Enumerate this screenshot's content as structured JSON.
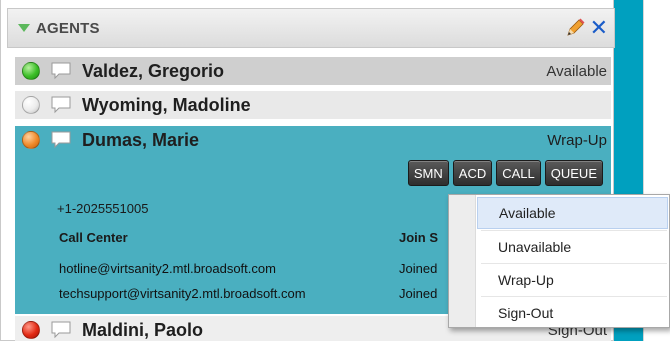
{
  "panel": {
    "title": "AGENTS"
  },
  "agents": [
    {
      "name": "Valdez, Gregorio",
      "status": "Available",
      "status_color": "green"
    },
    {
      "name": "Wyoming, Madoline",
      "status": "",
      "status_color": "white"
    },
    {
      "name": "Dumas, Marie",
      "status": "Wrap-Up",
      "status_color": "orange"
    },
    {
      "name": "Maldini, Paolo",
      "status": "Sign-Out",
      "status_color": "red"
    }
  ],
  "expanded_agent": {
    "buttons": [
      "SMN",
      "ACD",
      "CALL",
      "QUEUE"
    ],
    "phone": "+1-2025551005",
    "table": {
      "col_call_center": "Call Center",
      "col_join": "Join S",
      "rows": [
        {
          "call_center": "hotline@virtsanity2.mtl.broadsoft.com",
          "join": "Joined"
        },
        {
          "call_center": "techsupport@virtsanity2.mtl.broadsoft.com",
          "join": "Joined"
        }
      ]
    }
  },
  "status_menu": {
    "items": [
      "Available",
      "Unavailable",
      "Wrap-Up",
      "Sign-Out"
    ],
    "highlighted": "Available"
  },
  "colors": {
    "accent": "#00a0bf",
    "expanded_row": "#4aafc0",
    "close_icon": "#1a5cc8",
    "collapse_arrow": "#5cb85c"
  }
}
